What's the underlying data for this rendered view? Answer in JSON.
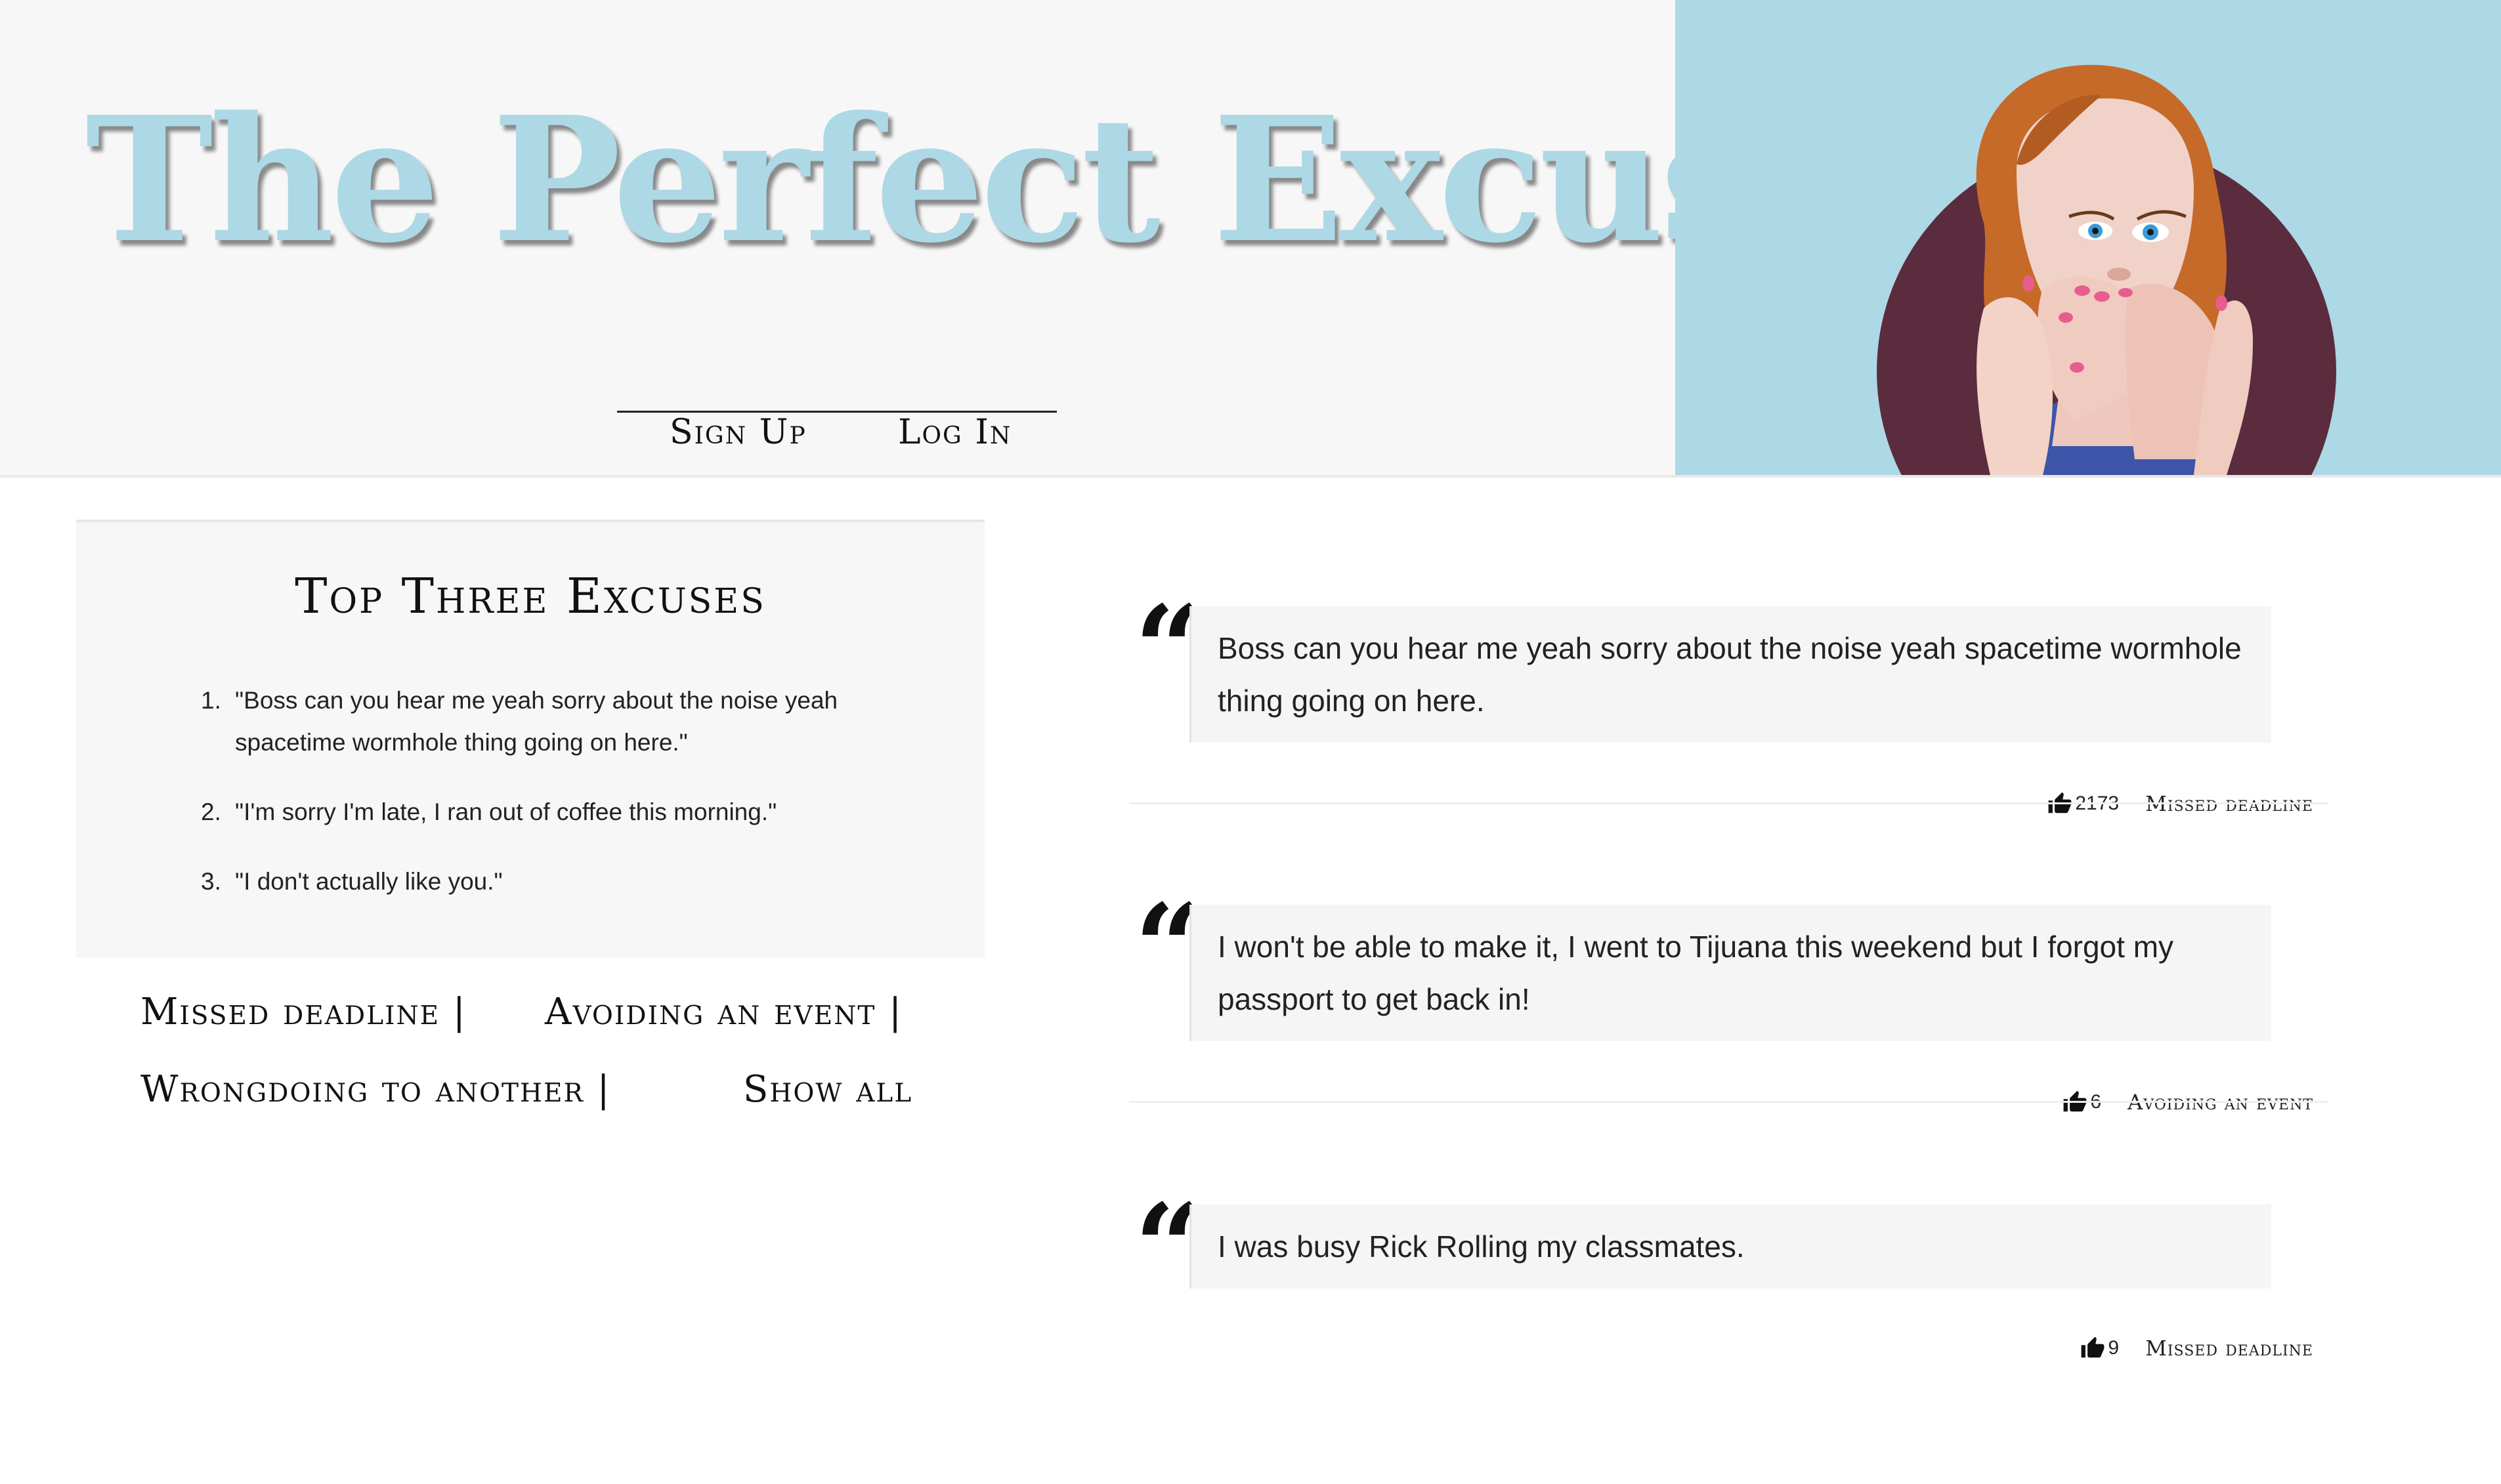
{
  "header": {
    "title": "The Perfect Excuse",
    "auth": {
      "signup": "Sign Up",
      "login": "Log In"
    }
  },
  "top_excuses": {
    "heading": "Top Three Excuses",
    "items": [
      {
        "num": "1.",
        "text": "\"Boss can you hear me yeah sorry about the noise yeah spacetime wormhole thing going on here.\""
      },
      {
        "num": "2.",
        "text": "\"I'm sorry I'm late, I ran out of coffee this morning.\""
      },
      {
        "num": "3.",
        "text": "\"I don't actually like you.\""
      }
    ]
  },
  "categories": {
    "missed": "Missed deadline |",
    "avoiding": "Avoiding an event |",
    "wrongdoing": "Wrongdoing to another |",
    "show_all": "Show all"
  },
  "feed": [
    {
      "text": "Boss can you hear me yeah sorry about the noise yeah spacetime wormhole thing going on here.",
      "votes": "2173",
      "category": "Missed deadline"
    },
    {
      "text": "I won't be able to make it, I went to Tijuana this weekend but I forgot my passport to get back in!",
      "votes": "6",
      "category": "Avoiding an event"
    },
    {
      "text": "I was busy Rick Rolling my classmates.",
      "votes": "9",
      "category": "Missed deadline"
    }
  ],
  "icons": {
    "quote": "quote-icon",
    "vote": "thumbs-up-icon"
  },
  "colors": {
    "brand": "#add8e6",
    "panel": "#f7f7f7",
    "quote_bg": "#f5f5f5"
  }
}
